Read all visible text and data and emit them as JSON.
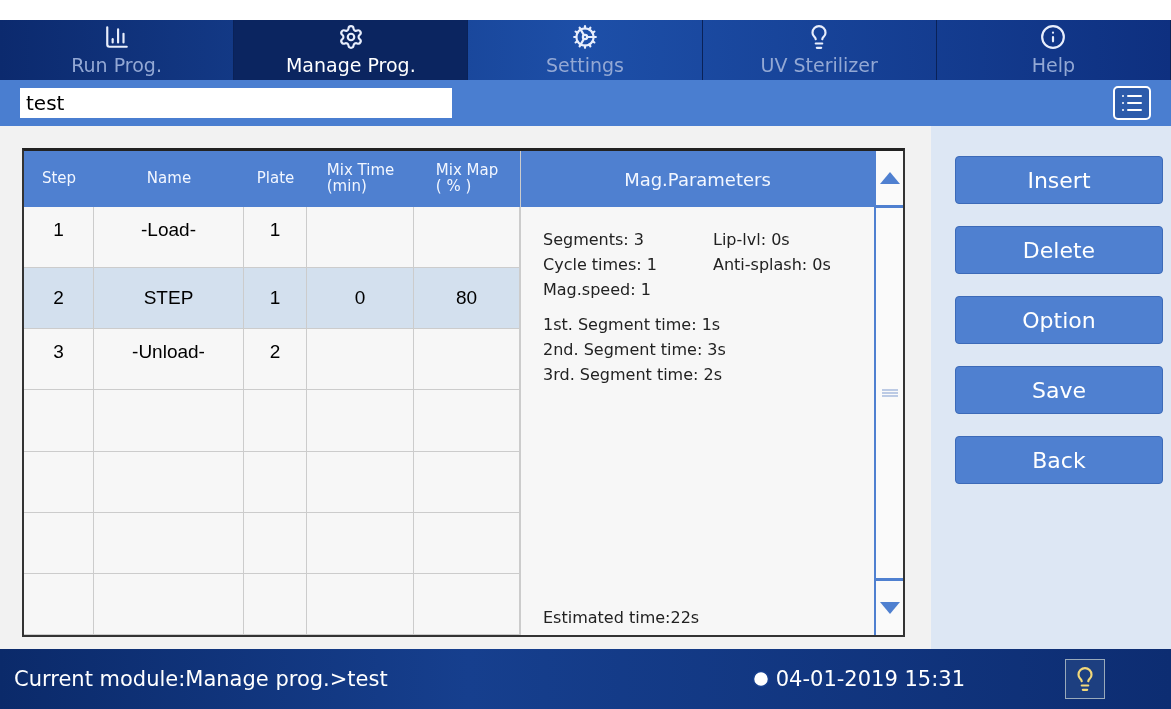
{
  "nav_tabs": [
    {
      "label": "Run Prog.",
      "selected": false
    },
    {
      "label": "Manage Prog.",
      "selected": true
    },
    {
      "label": "Settings",
      "selected": false
    },
    {
      "label": "UV Sterilizer",
      "selected": false
    },
    {
      "label": "Help",
      "selected": false
    }
  ],
  "program_name": {
    "value": "test"
  },
  "table": {
    "columns": [
      {
        "label": "Step"
      },
      {
        "label": "Name"
      },
      {
        "label": "Plate"
      },
      {
        "label": "Mix Time",
        "sub": "(min)"
      },
      {
        "label": "Mix Map",
        "sub": "( % )"
      }
    ],
    "rows": [
      {
        "cells": [
          "1",
          "-Load-",
          "1",
          "",
          ""
        ],
        "selected": false
      },
      {
        "cells": [
          "2",
          "STEP",
          "1",
          "0",
          "80"
        ],
        "selected": true
      },
      {
        "cells": [
          "3",
          "-Unload-",
          "2",
          "",
          ""
        ],
        "selected": false
      },
      {
        "cells": [
          "",
          "",
          "",
          "",
          ""
        ],
        "selected": false
      },
      {
        "cells": [
          "",
          "",
          "",
          "",
          ""
        ],
        "selected": false
      },
      {
        "cells": [
          "",
          "",
          "",
          "",
          ""
        ],
        "selected": false
      },
      {
        "cells": [
          "",
          "",
          "",
          "",
          ""
        ],
        "selected": false
      }
    ]
  },
  "mag_parameters": {
    "title": "Mag.Parameters",
    "settings": [
      [
        "Segments: 3",
        "Lip-lvl: 0s"
      ],
      [
        "Cycle times: 1",
        "Anti-splash: 0s"
      ],
      [
        "Mag.speed: 1"
      ]
    ],
    "segment_times": [
      "1st. Segment time: 1s",
      "2nd. Segment time: 3s",
      "3rd. Segment time: 2s"
    ],
    "estimated": "Estimated time:22s"
  },
  "buttons": [
    "Insert",
    "Delete",
    "Option",
    "Save",
    "Back"
  ],
  "status_bar": {
    "module": "Current module:Manage prog.>test",
    "datetime": "04-01-2019 15:31"
  }
}
